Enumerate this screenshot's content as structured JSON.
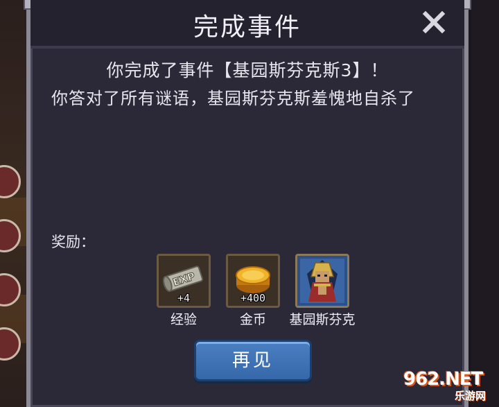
{
  "dialog": {
    "title": "完成事件",
    "message_line1": "你完成了事件【基园斯芬克斯3】！",
    "message_line2": "你答对了所有谜语，基园斯芬克斯羞愧地自杀了",
    "rewards_label": "奖励：",
    "rewards": [
      {
        "icon": "exp-scroll-icon",
        "amount": "+4",
        "name": "经验"
      },
      {
        "icon": "gold-coin-icon",
        "amount": "+400",
        "name": "金币"
      },
      {
        "icon": "sphinx-portrait-icon",
        "amount": "",
        "name": "基园斯芬克"
      }
    ],
    "ok_button": "再见",
    "close_icon": "close-icon"
  },
  "watermark": {
    "top": "962.NET",
    "bottom": "乐游网"
  },
  "colors": {
    "panel": "#2b2838",
    "frame": "#8a8995",
    "button": "#3f74b8",
    "text": "#e9e7ee"
  }
}
